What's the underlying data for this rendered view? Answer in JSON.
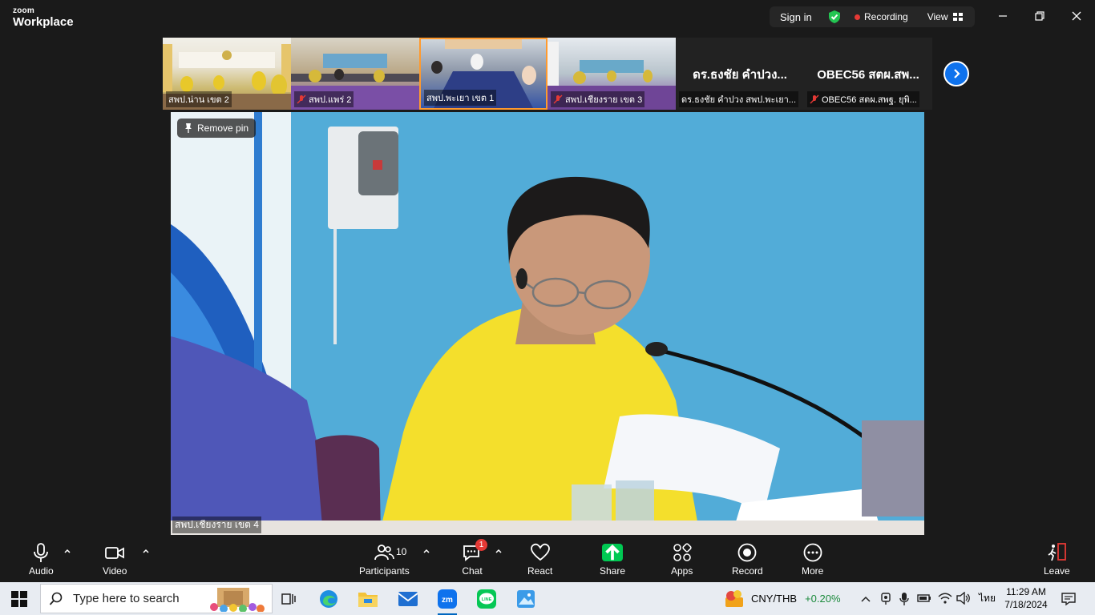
{
  "titlebar": {
    "brand_small": "zoom",
    "brand_large": "Workplace",
    "sign_in": "Sign in",
    "recording": "Recording",
    "view": "View"
  },
  "thumbnails": [
    {
      "name": "สพป.น่าน เขต 2",
      "muted": false,
      "video": true
    },
    {
      "name": "สพป.แพร่ 2",
      "muted": true,
      "video": true
    },
    {
      "name": "สพป.พะเยา เขต 1",
      "muted": false,
      "video": true
    },
    {
      "name": "สพป.เชียงราย เขต 3",
      "muted": true,
      "video": true
    },
    {
      "name": "ดร.ธงชัย คำปวง สพป.พะเยา...",
      "big": "ดร.ธงชัย คำปวง...",
      "muted": false,
      "video": false
    },
    {
      "name": "OBEC56 สตผ.สพฐ. ยุพิ...",
      "big": "OBEC56 สตผ.สพ...",
      "muted": true,
      "video": false
    }
  ],
  "main": {
    "remove_pin": "Remove pin",
    "speaker_name": "สพป.เชียงราย เขต 4"
  },
  "toolbar": {
    "audio": "Audio",
    "video": "Video",
    "participants": "Participants",
    "participants_count": "10",
    "chat": "Chat",
    "chat_badge": "1",
    "react": "React",
    "share": "Share",
    "apps": "Apps",
    "record": "Record",
    "more": "More",
    "leave": "Leave"
  },
  "taskbar": {
    "search_placeholder": "Type here to search",
    "currency": "CNY/THB",
    "currency_change": "+0.20%",
    "language": "ไทย",
    "time": "11:29 AM",
    "date": "7/18/2024"
  },
  "colors": {
    "accent_blue": "#0e72ed",
    "recording_red": "#e53935",
    "share_green": "#00c853",
    "positive_green": "#1b8a3c"
  }
}
